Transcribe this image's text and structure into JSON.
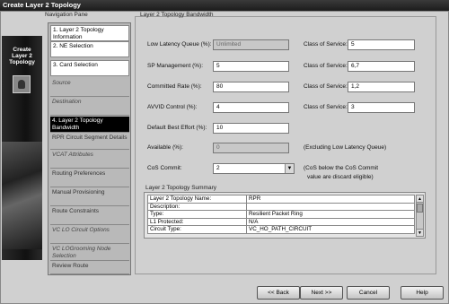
{
  "window": {
    "title": "Create Layer 2 Topology"
  },
  "brand": {
    "line1": "Create",
    "line2": "Layer 2",
    "line3": "Topology"
  },
  "nav": {
    "label": "Navigation Pane",
    "items": [
      {
        "label": "1. Layer 2 Topology Information",
        "state": "done"
      },
      {
        "label": "2. NE Selection",
        "state": "done"
      },
      {
        "label": "3. Card Selection",
        "state": "done"
      },
      {
        "label": "Source",
        "state": "disabled"
      },
      {
        "label": "Destination",
        "state": "disabled"
      },
      {
        "label": "4. Layer 2 Topology Bandwidth",
        "state": "current"
      },
      {
        "label": "RPR Circuit Segment Details",
        "state": "pending"
      },
      {
        "label": "VCAT Attributes",
        "state": "disabled"
      },
      {
        "label": "Routing Preferences",
        "state": "pending"
      },
      {
        "label": "Manual Provisioning",
        "state": "pending"
      },
      {
        "label": "Route Constraints",
        "state": "pending"
      },
      {
        "label": "VC LO Circuit Options",
        "state": "disabled"
      },
      {
        "label": "VC LOGrooming Node Selection",
        "state": "disabled"
      },
      {
        "label": "Review Route",
        "state": "pending"
      }
    ]
  },
  "bandwidth": {
    "group_label": "Layer 2 Topology Bandwidth",
    "low_latency_label": "Low Latency Queue (%):",
    "low_latency_value": "Unlimited",
    "sp_mgmt_label": "SP Management (%):",
    "sp_mgmt_value": "5",
    "committed_label": "Committed Rate (%):",
    "committed_value": "80",
    "avvid_label": "AVVID Control (%):",
    "avvid_value": "4",
    "best_effort_label": "Default Best Effort (%):",
    "best_effort_value": "10",
    "available_label": "Available (%):",
    "available_value": "0",
    "cos_commit_label": "CoS Commit:",
    "cos_commit_value": "2",
    "cos_label": "Class of Service:",
    "cos_values": [
      "5",
      "6,7",
      "1,2",
      "3"
    ],
    "excluding_note": "(Excluding Low Latency Queue)",
    "cos_note_line1": "(CoS below the CoS Commit",
    "cos_note_line2": "value are discard eligible)"
  },
  "summary": {
    "label": "Layer 2 Topology Summary",
    "rows": [
      {
        "key": "Layer 2 Topology Name:",
        "value": "RPR"
      },
      {
        "key": "Description:",
        "value": ""
      },
      {
        "key": "Type:",
        "value": "Resilient Packet Ring"
      },
      {
        "key": "L1 Protected:",
        "value": "N/A"
      },
      {
        "key": "Circuit Type:",
        "value": "VC_HO_PATH_CIRCUIT"
      }
    ]
  },
  "buttons": {
    "back": "<< Back",
    "next": "Next >>",
    "cancel": "Cancel",
    "help": "Help"
  }
}
